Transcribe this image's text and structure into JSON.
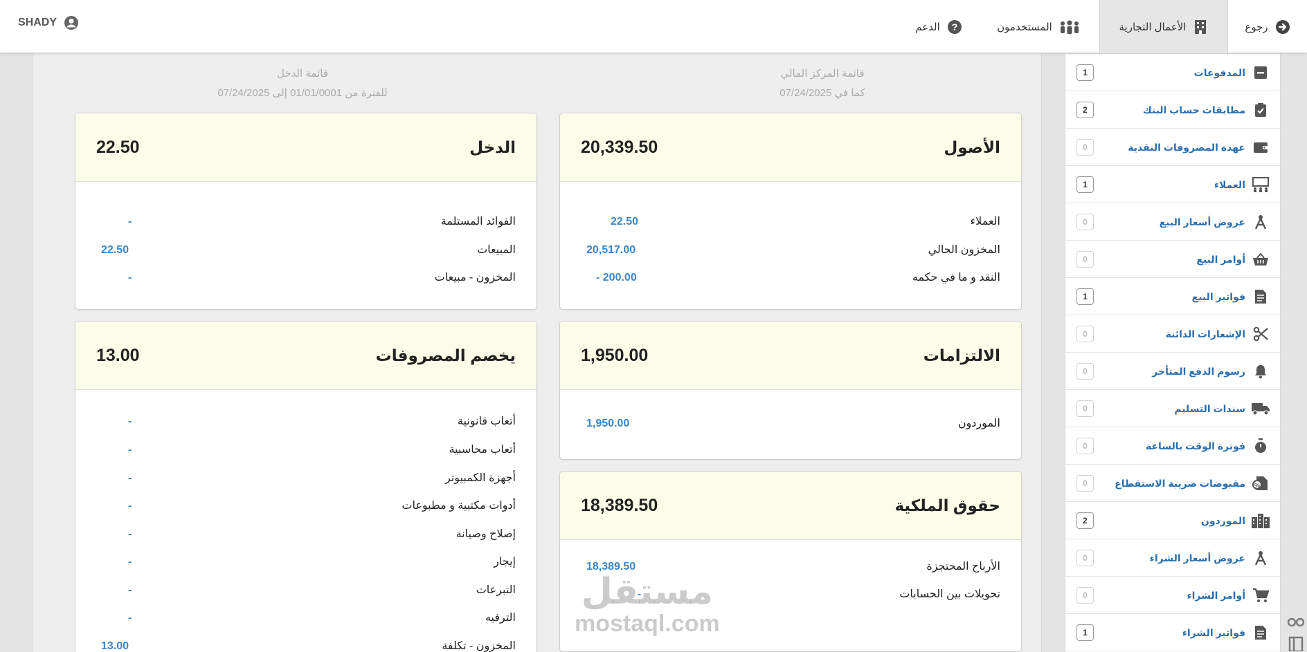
{
  "topbar": {
    "back_label": "رجوع",
    "business_label": "الأعمال التجارية",
    "users_label": "المستخدمون",
    "support_label": "الدعم",
    "username": "SHADY"
  },
  "sidebar": {
    "items": [
      {
        "label": "",
        "count": "",
        "icon": "list-icon"
      },
      {
        "label": "المدفوعات",
        "count": "1",
        "icon": "minus-box-icon"
      },
      {
        "label": "مطابقات حساب البنك",
        "count": "2",
        "icon": "clipboard-check-icon"
      },
      {
        "label": "عهدة المصروفات النقدية",
        "count": "0",
        "icon": "wallet-icon"
      },
      {
        "label": "العملاء",
        "count": "1",
        "icon": "presentation-icon"
      },
      {
        "label": "عروض أسعار البيع",
        "count": "0",
        "icon": "compass-icon"
      },
      {
        "label": "أوامر البيع",
        "count": "0",
        "icon": "basket-icon"
      },
      {
        "label": "فواتير البيع",
        "count": "1",
        "icon": "invoice-icon"
      },
      {
        "label": "الإشعارات الدائنة",
        "count": "0",
        "icon": "scissors-icon"
      },
      {
        "label": "رسوم الدفع المتأخر",
        "count": "0",
        "icon": "bell-icon"
      },
      {
        "label": "سندات التسليم",
        "count": "0",
        "icon": "truck-icon"
      },
      {
        "label": "فوترة الوقت بالساعة",
        "count": "0",
        "icon": "stopwatch-icon"
      },
      {
        "label": "مقبوضات ضريبة الاستقطاع",
        "count": "0",
        "icon": "receipt-tax-icon"
      },
      {
        "label": "الموردون",
        "count": "2",
        "icon": "building-icon"
      },
      {
        "label": "عروض أسعار الشراء",
        "count": "0",
        "icon": "compass-icon"
      },
      {
        "label": "أوامر الشراء",
        "count": "0",
        "icon": "cart-icon"
      },
      {
        "label": "فواتير الشراء",
        "count": "1",
        "icon": "invoice-icon"
      }
    ]
  },
  "reports": {
    "balance_sheet": {
      "title": "قائمة المركز المالي",
      "subtitle": "كما في 07/24/2025"
    },
    "income_statement": {
      "title": "قائمة الدخل",
      "subtitle": "للفترة من 01/01/0001 إلى 07/24/2025"
    }
  },
  "cards": {
    "assets": {
      "title": "الأصول",
      "total": "20,339.50",
      "rows": [
        {
          "label": "العملاء",
          "value": "22.50"
        },
        {
          "label": "المخزون الحالي",
          "value": "20,517.00"
        },
        {
          "label": "النقد و ما في حكمه",
          "value": "- 200.00"
        }
      ]
    },
    "liabilities": {
      "title": "الالتزامات",
      "total": "1,950.00",
      "rows": [
        {
          "label": "الموردون",
          "value": "1,950.00"
        }
      ]
    },
    "equity": {
      "title": "حقوق الملكية",
      "total": "18,389.50",
      "rows": [
        {
          "label": "الأرباح المحتجزة",
          "value": "18,389.50"
        },
        {
          "label": "تحويلات بين الحسابات",
          "value": "-"
        }
      ]
    },
    "income": {
      "title": "الدخل",
      "total": "22.50",
      "rows": [
        {
          "label": "الفوائد المستلمة",
          "value": "-"
        },
        {
          "label": "المبيعات",
          "value": "22.50"
        },
        {
          "label": "المخزون - مبيعات",
          "value": "-"
        }
      ]
    },
    "expenses": {
      "title": "يخصم المصروفات",
      "total": "13.00",
      "rows": [
        {
          "label": "أتعاب قانونية",
          "value": "-"
        },
        {
          "label": "أتعاب محاسبية",
          "value": "-"
        },
        {
          "label": "أجهزة الكمبيوتر",
          "value": "-"
        },
        {
          "label": "أدوات مكتبية و مطبوعات",
          "value": "-"
        },
        {
          "label": "إصلاح وصيانة",
          "value": "-"
        },
        {
          "label": "إيجار",
          "value": "-"
        },
        {
          "label": "التبرعات",
          "value": "-"
        },
        {
          "label": "الترفيه",
          "value": "-"
        },
        {
          "label": "المخزون - تكلفة",
          "value": "13.00"
        }
      ]
    }
  },
  "watermark": {
    "arabic": "مستقل",
    "latin": "mostaql.com"
  },
  "colors": {
    "link": "#3a86c8",
    "card_header": "#fcfde8",
    "sidebar_link": "#2a6fb0"
  }
}
